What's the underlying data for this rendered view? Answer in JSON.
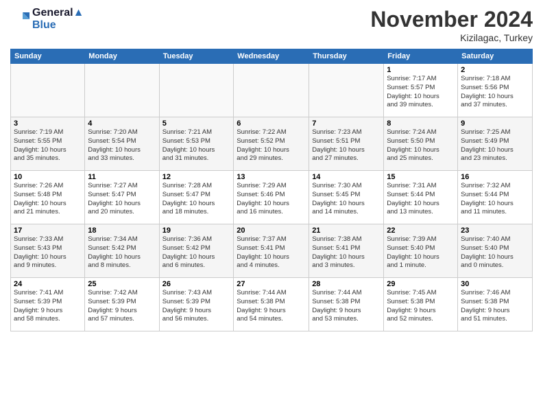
{
  "header": {
    "logo_line1": "General",
    "logo_line2": "Blue",
    "month_title": "November 2024",
    "location": "Kizilagac, Turkey"
  },
  "weekdays": [
    "Sunday",
    "Monday",
    "Tuesday",
    "Wednesday",
    "Thursday",
    "Friday",
    "Saturday"
  ],
  "weeks": [
    [
      {
        "day": "",
        "info": ""
      },
      {
        "day": "",
        "info": ""
      },
      {
        "day": "",
        "info": ""
      },
      {
        "day": "",
        "info": ""
      },
      {
        "day": "",
        "info": ""
      },
      {
        "day": "1",
        "info": "Sunrise: 7:17 AM\nSunset: 5:57 PM\nDaylight: 10 hours\nand 39 minutes."
      },
      {
        "day": "2",
        "info": "Sunrise: 7:18 AM\nSunset: 5:56 PM\nDaylight: 10 hours\nand 37 minutes."
      }
    ],
    [
      {
        "day": "3",
        "info": "Sunrise: 7:19 AM\nSunset: 5:55 PM\nDaylight: 10 hours\nand 35 minutes."
      },
      {
        "day": "4",
        "info": "Sunrise: 7:20 AM\nSunset: 5:54 PM\nDaylight: 10 hours\nand 33 minutes."
      },
      {
        "day": "5",
        "info": "Sunrise: 7:21 AM\nSunset: 5:53 PM\nDaylight: 10 hours\nand 31 minutes."
      },
      {
        "day": "6",
        "info": "Sunrise: 7:22 AM\nSunset: 5:52 PM\nDaylight: 10 hours\nand 29 minutes."
      },
      {
        "day": "7",
        "info": "Sunrise: 7:23 AM\nSunset: 5:51 PM\nDaylight: 10 hours\nand 27 minutes."
      },
      {
        "day": "8",
        "info": "Sunrise: 7:24 AM\nSunset: 5:50 PM\nDaylight: 10 hours\nand 25 minutes."
      },
      {
        "day": "9",
        "info": "Sunrise: 7:25 AM\nSunset: 5:49 PM\nDaylight: 10 hours\nand 23 minutes."
      }
    ],
    [
      {
        "day": "10",
        "info": "Sunrise: 7:26 AM\nSunset: 5:48 PM\nDaylight: 10 hours\nand 21 minutes."
      },
      {
        "day": "11",
        "info": "Sunrise: 7:27 AM\nSunset: 5:47 PM\nDaylight: 10 hours\nand 20 minutes."
      },
      {
        "day": "12",
        "info": "Sunrise: 7:28 AM\nSunset: 5:47 PM\nDaylight: 10 hours\nand 18 minutes."
      },
      {
        "day": "13",
        "info": "Sunrise: 7:29 AM\nSunset: 5:46 PM\nDaylight: 10 hours\nand 16 minutes."
      },
      {
        "day": "14",
        "info": "Sunrise: 7:30 AM\nSunset: 5:45 PM\nDaylight: 10 hours\nand 14 minutes."
      },
      {
        "day": "15",
        "info": "Sunrise: 7:31 AM\nSunset: 5:44 PM\nDaylight: 10 hours\nand 13 minutes."
      },
      {
        "day": "16",
        "info": "Sunrise: 7:32 AM\nSunset: 5:44 PM\nDaylight: 10 hours\nand 11 minutes."
      }
    ],
    [
      {
        "day": "17",
        "info": "Sunrise: 7:33 AM\nSunset: 5:43 PM\nDaylight: 10 hours\nand 9 minutes."
      },
      {
        "day": "18",
        "info": "Sunrise: 7:34 AM\nSunset: 5:42 PM\nDaylight: 10 hours\nand 8 minutes."
      },
      {
        "day": "19",
        "info": "Sunrise: 7:36 AM\nSunset: 5:42 PM\nDaylight: 10 hours\nand 6 minutes."
      },
      {
        "day": "20",
        "info": "Sunrise: 7:37 AM\nSunset: 5:41 PM\nDaylight: 10 hours\nand 4 minutes."
      },
      {
        "day": "21",
        "info": "Sunrise: 7:38 AM\nSunset: 5:41 PM\nDaylight: 10 hours\nand 3 minutes."
      },
      {
        "day": "22",
        "info": "Sunrise: 7:39 AM\nSunset: 5:40 PM\nDaylight: 10 hours\nand 1 minute."
      },
      {
        "day": "23",
        "info": "Sunrise: 7:40 AM\nSunset: 5:40 PM\nDaylight: 10 hours\nand 0 minutes."
      }
    ],
    [
      {
        "day": "24",
        "info": "Sunrise: 7:41 AM\nSunset: 5:39 PM\nDaylight: 9 hours\nand 58 minutes."
      },
      {
        "day": "25",
        "info": "Sunrise: 7:42 AM\nSunset: 5:39 PM\nDaylight: 9 hours\nand 57 minutes."
      },
      {
        "day": "26",
        "info": "Sunrise: 7:43 AM\nSunset: 5:39 PM\nDaylight: 9 hours\nand 56 minutes."
      },
      {
        "day": "27",
        "info": "Sunrise: 7:44 AM\nSunset: 5:38 PM\nDaylight: 9 hours\nand 54 minutes."
      },
      {
        "day": "28",
        "info": "Sunrise: 7:44 AM\nSunset: 5:38 PM\nDaylight: 9 hours\nand 53 minutes."
      },
      {
        "day": "29",
        "info": "Sunrise: 7:45 AM\nSunset: 5:38 PM\nDaylight: 9 hours\nand 52 minutes."
      },
      {
        "day": "30",
        "info": "Sunrise: 7:46 AM\nSunset: 5:38 PM\nDaylight: 9 hours\nand 51 minutes."
      }
    ]
  ]
}
